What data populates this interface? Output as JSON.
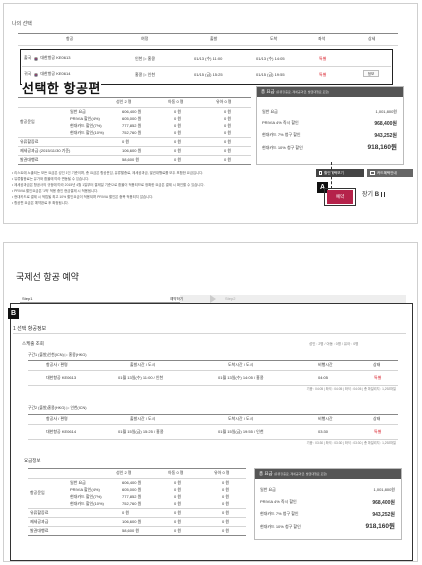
{
  "panel_a": {
    "title": "나의 선택",
    "flight_headers": [
      "항공",
      "여정",
      "출발",
      "도착",
      "좌석",
      "상세"
    ],
    "flights": [
      {
        "direction": "출국",
        "airline": "대한항공 KE0613",
        "route": "인천 ▷ 홍콩",
        "depart": "01/13 (수) 11:00",
        "arrive": "01/13 (수) 14:05",
        "seat": "특별",
        "detail": ""
      },
      {
        "direction": "귀국",
        "airline": "대한항공 KE0614",
        "route": "홍콩 ▷ 인천",
        "depart": "01/15 (금) 15:25",
        "arrive": "01/15 (금) 19:55",
        "seat": "특별",
        "detail": "정보"
      }
    ],
    "selected_label": "선택한 항공편",
    "fare_headers": [
      "성인 2 명",
      "아동 0 명",
      "유아 0 명"
    ],
    "fare_rows": [
      {
        "group": "항공운임",
        "label": "일반 요금",
        "adult": "606,400 원",
        "child": "0 원",
        "infant": "0 원"
      },
      {
        "group": "",
        "label": "PRIVIA 할인(4%)",
        "adult": "605,000 원",
        "child": "0 원",
        "infant": "0 원"
      },
      {
        "group": "",
        "label": "현대카드 할인(7%)",
        "adult": "777,852 원",
        "child": "0 원",
        "infant": "0 원"
      },
      {
        "group": "",
        "label": "현대카드 할인(10%)",
        "adult": "752,760 원",
        "child": "0 원",
        "infant": "0 원"
      },
      {
        "group": "유류할증료",
        "label": "",
        "adult": "0 원",
        "child": "0 원",
        "infant": "0 원"
      },
      {
        "group": "제세공과금 (2015/11/30 기준)",
        "label": "",
        "adult": "106,600 원",
        "child": "0 원",
        "infant": "0 원"
      },
      {
        "group": "발권대행료",
        "label": "",
        "adult": "58,600 원",
        "child": "0 원",
        "infant": "0 원"
      }
    ],
    "total": {
      "title": "총 요금",
      "subtitle": "(유류할증료, 제세공과금, 발권대행료 포함)",
      "rows": [
        {
          "label": "일반 요금",
          "value": "1,001,800원"
        },
        {
          "label": "PRIVIA 4% 즉시 할인",
          "value": "968,400원"
        },
        {
          "label": "현대카드 7% 청구 할인",
          "value": "943,252원"
        },
        {
          "label": "현대카드 10% 청구 할인",
          "value": "918,160원"
        }
      ]
    },
    "notes": [
      "• 리스트에 노출되는 모든 요금은 성인 1인 기준이며, 총 요금은 항공운임, 유류할증료, 제세공과금, 발권대행료를 모두 포함한 요금입니다.",
      "• 유류할증료는 유가와 환율에 따라 변동될 수 있습니다.",
      "• 제세공과금은 항공사의 규정에 따라 2015년 4월 1일부터 결제일 기준으로 환율이 적용되므로 정확한 요금은 결제 시 확인할 수 있습니다.",
      "• PRIVIA 할인요금은 '1박' 적용 중인 현금결제 시 적용됩니다.",
      "• 현대카드로 결제 시 적립될 최고 10% 할인요금이 적용되며 PRIVIA 할인은 중복 적용되지 않습니다.",
      "• 항공편 요금은 예약완료 후 확정됩니다."
    ],
    "buttons": {
      "discount": "할인혜택보기",
      "card_benefit": "카드혜택안내",
      "reserve": "예약",
      "cart_label": "장기",
      "cart_badge": "B"
    },
    "marker": "A"
  },
  "panel_b": {
    "title": "국제선 항공 예약",
    "steps": [
      "Step1",
      "예약하기",
      "Step2"
    ],
    "marker": "B",
    "section_title": "1 선택 항공정보",
    "schedule_title": "스케줄 조회",
    "schedule_meta": "성인 : 2명 / 아동 : 0명 / 유아 : 0명",
    "legs": [
      {
        "leg_title": "구간1 (출발)인천(ICN) ▷ 홍콩(HKG)",
        "headers": [
          "항공사 / 편명",
          "출발시간 / 도시",
          "도착시간 / 도시",
          "비행시간",
          "상태"
        ],
        "airline": "대한항공 KE0613",
        "depart": "01월 13일(수) 11:00 / 인천",
        "arrive": "01월 13일(수) 14:05 / 홍콩",
        "duration": "04:05",
        "status": "특별",
        "footnote": "기종 : 04:05 | 좌석 : 04:05 | 좌석 : 04:05 | 총 마일리지 : 1,292마일"
      },
      {
        "leg_title": "구간2 (출발)홍콩(HKG) ▷ 인천(ICN)",
        "headers": [
          "항공사 / 편명",
          "출발시간 / 도시",
          "도착시간 / 도시",
          "비행시간",
          "상태"
        ],
        "airline": "대한항공 KE0614",
        "depart": "01월 15일(금) 15:25 / 홍콩",
        "arrive": "01월 15일(금) 19:55 / 인천",
        "duration": "03:30",
        "status": "특별",
        "footnote": "기종 : 03:30 | 좌석 : 03:30 | 좌석 : 03:30 | 총 마일리지 : 1,292마일"
      }
    ],
    "fare_title": "요금정보",
    "fare_headers": [
      "성인 2 명",
      "아동 0 명",
      "유아 0 명"
    ],
    "fare_rows": [
      {
        "group": "항공운임",
        "label": "일반 요금",
        "adult": "606,400 원",
        "child": "0 원",
        "infant": "0 원"
      },
      {
        "group": "",
        "label": "PRIVIA 할인(4%)",
        "adult": "605,000 원",
        "child": "0 원",
        "infant": "0 원"
      },
      {
        "group": "",
        "label": "현대카드 할인(7%)",
        "adult": "777,852 원",
        "child": "0 원",
        "infant": "0 원"
      },
      {
        "group": "",
        "label": "현대카드 할인(10%)",
        "adult": "752,760 원",
        "child": "0 원",
        "infant": "0 원"
      },
      {
        "group": "유류할증료",
        "label": "",
        "adult": "0 원",
        "child": "0 원",
        "infant": "0 원"
      },
      {
        "group": "제세공과금",
        "label": "",
        "adult": "106,600 원",
        "child": "0 원",
        "infant": "0 원"
      },
      {
        "group": "발권대행료",
        "label": "",
        "adult": "58,600 원",
        "child": "0 원",
        "infant": "0 원"
      }
    ],
    "total": {
      "title": "총 요금",
      "subtitle": "(유류할증료, 제세공과금, 발권대행료 포함)",
      "rows": [
        {
          "label": "일반 요금",
          "value": "1,001,800원"
        },
        {
          "label": "PRIVIA 4% 즉시 할인",
          "value": "968,400원"
        },
        {
          "label": "현대카드 7% 청구 할인",
          "value": "943,252원"
        },
        {
          "label": "현대카드 10% 청구 할인",
          "value": "918,160원"
        }
      ]
    }
  }
}
